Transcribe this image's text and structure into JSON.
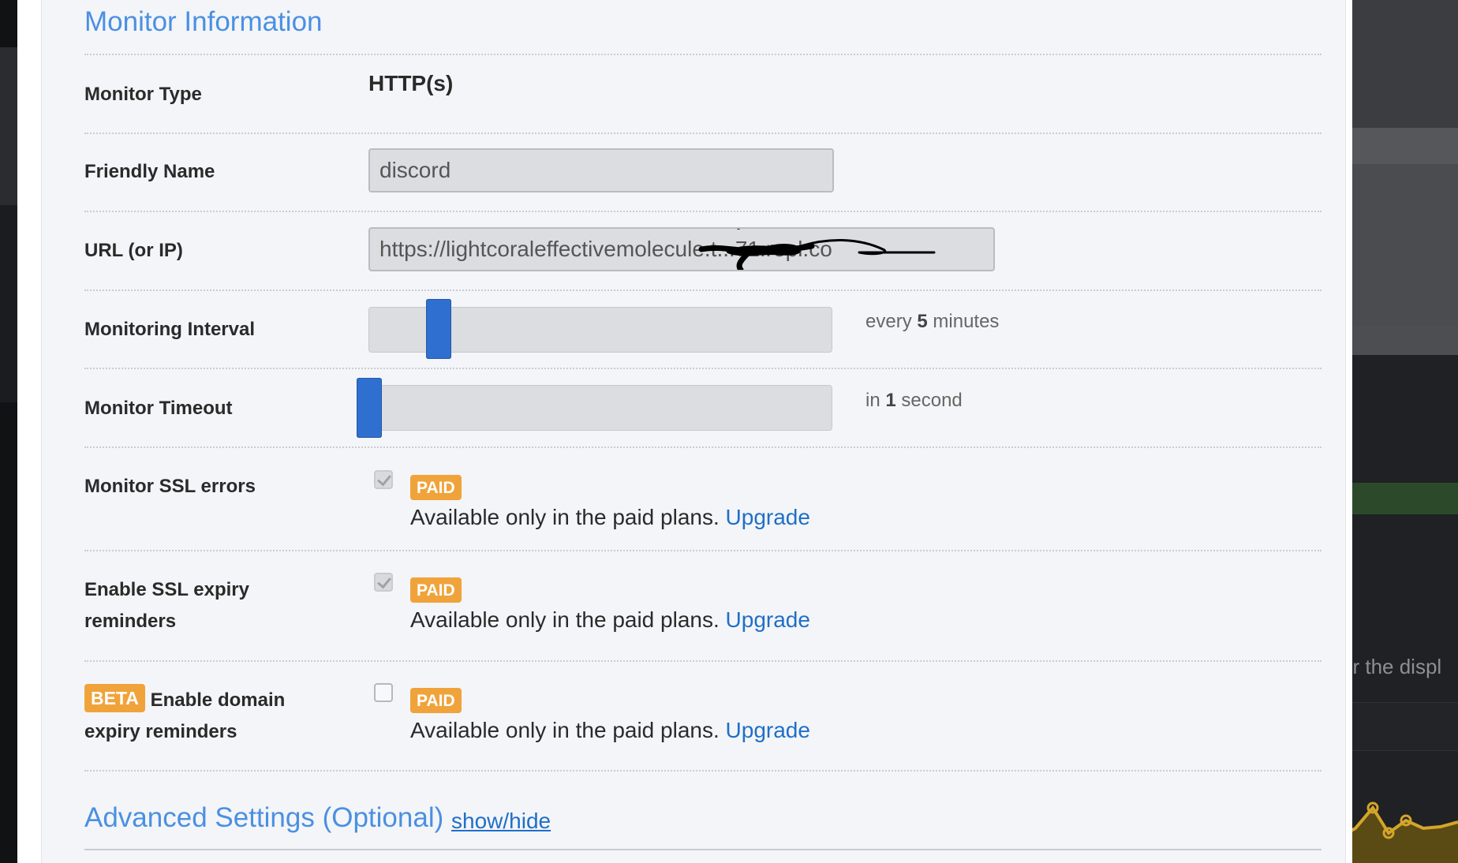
{
  "monitor_info": {
    "title": "Monitor Information",
    "type_label": "Monitor Type",
    "type_value": "HTTP(s)",
    "friendly_name_label": "Friendly Name",
    "friendly_name_value": "discord",
    "url_label": "URL (or IP)",
    "url_value": "https://lightcoraleffectivemolecule.t...71.repl.co",
    "interval_label": "Monitoring Interval",
    "interval_hint_prefix": "every",
    "interval_value": "5",
    "interval_hint_suffix": "minutes",
    "timeout_label": "Monitor Timeout",
    "timeout_hint_prefix": "in",
    "timeout_value": "1",
    "timeout_hint_suffix": "second",
    "ssl_errors_label": "Monitor SSL errors",
    "ssl_expiry_label_1": "Enable SSL expiry",
    "ssl_expiry_label_2": "reminders",
    "domain_beta": "BETA",
    "domain_label_1": "Enable domain",
    "domain_label_2": "expiry reminders",
    "paid_badge": "PAID",
    "paid_text": "Available only in the paid plans.",
    "upgrade_link": "Upgrade"
  },
  "advanced": {
    "title": "Advanced Settings (Optional)",
    "toggle_link": "show/hide"
  },
  "background": {
    "partial_text": "or the displ"
  },
  "colors": {
    "accent": "#4a90e2",
    "link": "#1f6fc8",
    "badge": "#f0a33a",
    "slider": "#2f6fcf"
  }
}
